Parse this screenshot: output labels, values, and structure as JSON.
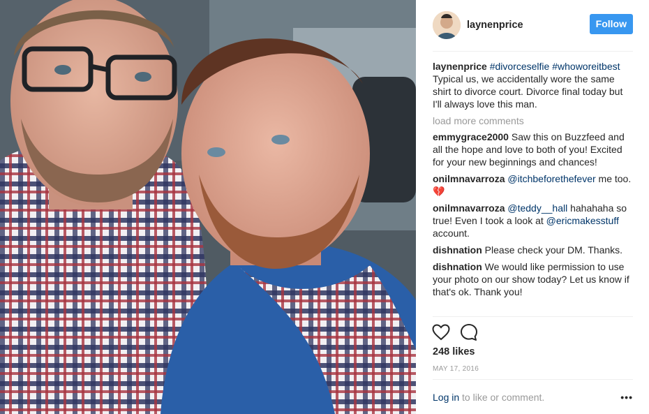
{
  "post": {
    "username": "laynenprice",
    "follow_label": "Follow",
    "caption": {
      "user": "laynenprice",
      "hashtag1": "#divorceselfie",
      "hashtag2": "#whoworeitbest",
      "text": " Typical us, we accidentally wore the same shirt to divorce court. Divorce final today but I'll always love this man."
    },
    "load_more": "load more comments",
    "comments": [
      {
        "user": "emmygrace2000",
        "text": " Saw this on Buzzfeed and all the hope and love to both of you! Excited for your new beginnings and chances!"
      },
      {
        "user": "onilmnavarroza",
        "mention": "@itchbeforethefever",
        "text": " me too. 💔"
      },
      {
        "user": "onilmnavarroza",
        "mention": "@teddy__hall",
        "text": " hahahaha so true! Even I took a look at ",
        "mention2": "@ericmakesstuff",
        "text2": " account."
      },
      {
        "user": "dishnation",
        "text": " Please check your DM. Thanks."
      },
      {
        "user": "dishnation",
        "text": " We would like permission to use your photo on our show today? Let us know if that's ok. Thank you!"
      }
    ],
    "likes": "248 likes",
    "date": "MAY 17, 2016",
    "footer": {
      "login": "Log in",
      "rest": " to like or comment.",
      "more": "•••"
    }
  },
  "icons": {
    "like": "heart-outline-icon",
    "comment": "speech-bubble-icon",
    "more": "more-dots-icon"
  },
  "colors": {
    "follow_bg": "#3897f0",
    "link": "#003569",
    "muted": "#999999",
    "text": "#262626"
  }
}
